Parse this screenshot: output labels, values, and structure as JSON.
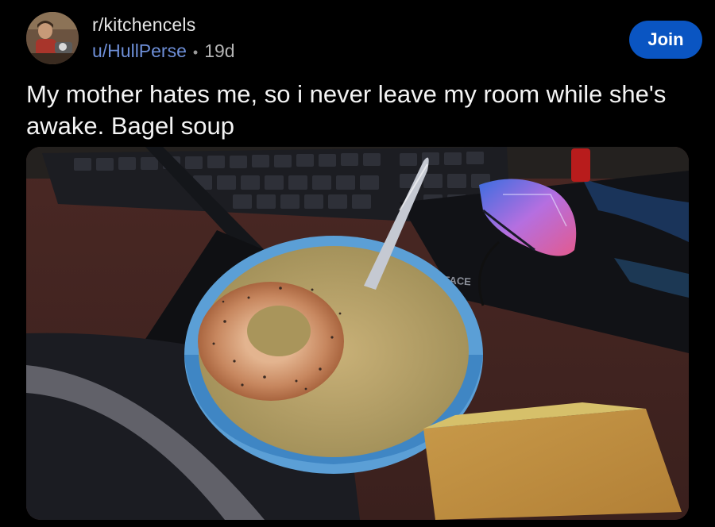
{
  "post": {
    "subreddit": "r/kitchencels",
    "username": "u/HullPerse",
    "separator": "•",
    "age": "19d",
    "join_label": "Join",
    "title": "My mother hates me, so i never leave my room while she's awake. Bagel soup"
  },
  "media": {
    "mousepad_text": "FACE"
  },
  "colors": {
    "join_button": "#0a55c2",
    "username": "#6e8fd8",
    "background": "#000000"
  }
}
